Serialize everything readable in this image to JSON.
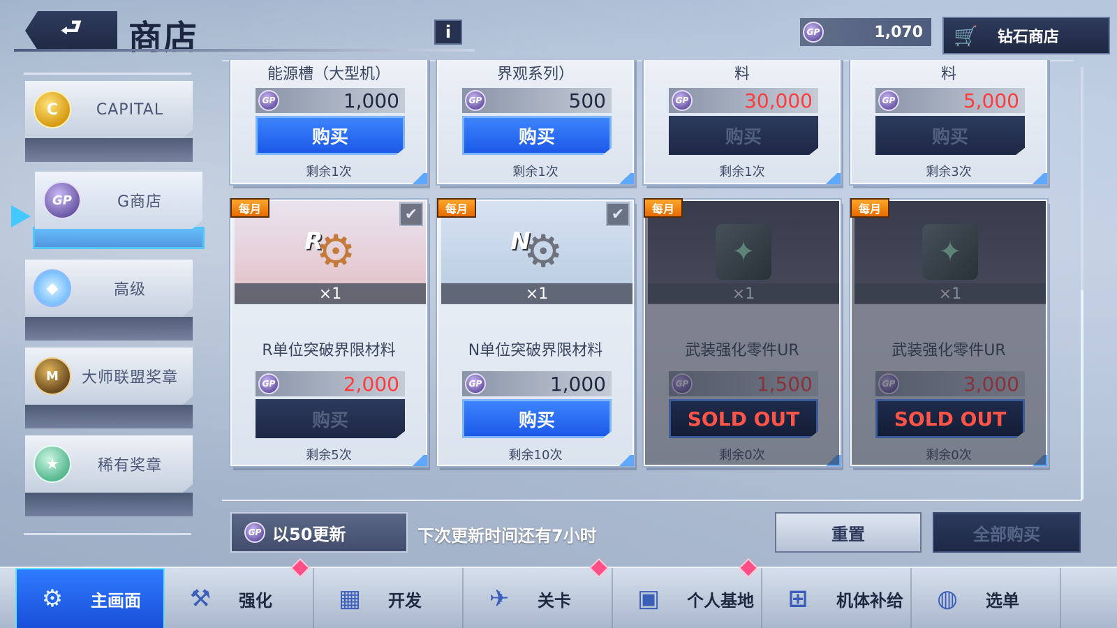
{
  "header": {
    "back_glyph": "⮐",
    "title": "商店",
    "info_label": "i",
    "currency_icon": "GP",
    "currency_amount": "1,070",
    "diamond_shop_label": "钻石商店"
  },
  "sidebar": {
    "items": [
      {
        "label": "CAPITAL",
        "icon": "C",
        "icon_name": "capital-coin-icon",
        "active": false
      },
      {
        "label": "G商店",
        "icon": "GP",
        "icon_name": "gp-coin-icon",
        "active": true
      },
      {
        "label": "高级",
        "icon": "◆",
        "icon_name": "diamond-icon",
        "active": false
      },
      {
        "label": "大师联盟奖章",
        "icon": "M",
        "icon_name": "master-league-medal-icon",
        "active": false
      },
      {
        "label": "稀有奖章",
        "icon": "★",
        "icon_name": "rare-medal-icon",
        "active": false
      }
    ]
  },
  "top_row": [
    {
      "name": "能源槽（大型机）",
      "price": "1,000",
      "price_red": false,
      "buy": "购买",
      "buy_state": "enabled",
      "remain": "剩余1次"
    },
    {
      "name": "界观系列）",
      "price": "500",
      "price_red": false,
      "buy": "购买",
      "buy_state": "enabled",
      "remain": "剩余1次"
    },
    {
      "name": "料",
      "price": "30,000",
      "price_red": true,
      "buy": "购买",
      "buy_state": "disabled",
      "remain": "剩余1次"
    },
    {
      "name": "料",
      "price": "5,000",
      "price_red": true,
      "buy": "购买",
      "buy_state": "disabled",
      "remain": "剩余3次"
    }
  ],
  "bottom_row": [
    {
      "badge": "每月",
      "tag": "R",
      "qty": "×1",
      "name": "R单位突破界限材料",
      "price": "2,000",
      "price_red": true,
      "buy": "购买",
      "buy_state": "disabled",
      "remain": "剩余5次",
      "checked": true,
      "dim": false
    },
    {
      "badge": "每月",
      "tag": "N",
      "qty": "×1",
      "name": "N单位突破界限材料",
      "price": "1,000",
      "price_red": false,
      "buy": "购买",
      "buy_state": "enabled",
      "remain": "剩余10次",
      "checked": true,
      "dim": false
    },
    {
      "badge": "每月",
      "tag": "",
      "qty": "×1",
      "name": "武装强化零件UR",
      "price": "1,500",
      "price_red": true,
      "buy": "SOLD OUT",
      "buy_state": "soldout",
      "remain": "剩余0次",
      "checked": false,
      "dim": true
    },
    {
      "badge": "每月",
      "tag": "",
      "qty": "×1",
      "name": "武装强化零件UR",
      "price": "3,000",
      "price_red": true,
      "buy": "SOLD OUT",
      "buy_state": "soldout",
      "remain": "剩余0次",
      "checked": false,
      "dim": true
    }
  ],
  "controls": {
    "refresh_label": "以50更新",
    "next_refresh": "下次更新时间还有7小时",
    "reset_label": "重置",
    "buy_all_label": "全部购买"
  },
  "nav": [
    {
      "label": "主画面",
      "icon": "⚙",
      "icon_name": "home-emblem-icon",
      "active": true,
      "alert": false
    },
    {
      "label": "强化",
      "icon": "⚒",
      "icon_name": "enhance-arm-icon",
      "active": false,
      "alert": true
    },
    {
      "label": "开发",
      "icon": "▦",
      "icon_name": "develop-lab-icon",
      "active": false,
      "alert": false
    },
    {
      "label": "关卡",
      "icon": "✈",
      "icon_name": "stage-gun-icon",
      "active": false,
      "alert": true
    },
    {
      "label": "个人基地",
      "icon": "▣",
      "icon_name": "base-building-icon",
      "active": false,
      "alert": true
    },
    {
      "label": "机体补给",
      "icon": "⊞",
      "icon_name": "supply-crate-icon",
      "active": false,
      "alert": false
    },
    {
      "label": "选单",
      "icon": "◍",
      "icon_name": "menu-globe-icon",
      "active": false,
      "alert": false
    }
  ]
}
